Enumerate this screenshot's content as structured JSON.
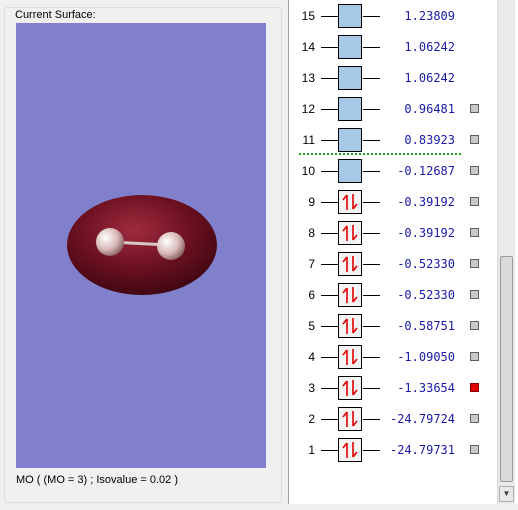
{
  "surface_group": {
    "title": "Current Surface:",
    "status": "MO ( (MO = 3) ; Isovalue = 0.02 )",
    "background_color": "#8080cc",
    "molecule": "dimer with isosurface"
  },
  "orbitals": [
    {
      "num": "15",
      "energy": "1.23809",
      "occupied": false,
      "selectable": false,
      "selected": false
    },
    {
      "num": "14",
      "energy": "1.06242",
      "occupied": false,
      "selectable": false,
      "selected": false
    },
    {
      "num": "13",
      "energy": "1.06242",
      "occupied": false,
      "selectable": false,
      "selected": false
    },
    {
      "num": "12",
      "energy": "0.96481",
      "occupied": false,
      "selectable": true,
      "selected": false
    },
    {
      "num": "11",
      "energy": "0.83923",
      "occupied": false,
      "selectable": true,
      "selected": false
    },
    {
      "num": "10",
      "energy": "-0.12687",
      "occupied": false,
      "selectable": true,
      "selected": false
    },
    {
      "num": "9",
      "energy": "-0.39192",
      "occupied": true,
      "selectable": true,
      "selected": false
    },
    {
      "num": "8",
      "energy": "-0.39192",
      "occupied": true,
      "selectable": true,
      "selected": false
    },
    {
      "num": "7",
      "energy": "-0.52330",
      "occupied": true,
      "selectable": true,
      "selected": false
    },
    {
      "num": "6",
      "energy": "-0.52330",
      "occupied": true,
      "selectable": true,
      "selected": false
    },
    {
      "num": "5",
      "energy": "-0.58751",
      "occupied": true,
      "selectable": true,
      "selected": false
    },
    {
      "num": "4",
      "energy": "-1.09050",
      "occupied": true,
      "selectable": true,
      "selected": false
    },
    {
      "num": "3",
      "energy": "-1.33654",
      "occupied": true,
      "selectable": true,
      "selected": true
    },
    {
      "num": "2",
      "energy": "-24.79724",
      "occupied": true,
      "selectable": true,
      "selected": false
    },
    {
      "num": "1",
      "energy": "-24.79731",
      "occupied": true,
      "selectable": true,
      "selected": false
    }
  ],
  "colors": {
    "unoccupied_box": "#a8c8e8",
    "energy_text": "#1a1aa6",
    "selected_marker": "#e00000",
    "homo_lumo_line": "#1ca61c",
    "spin_arrows": "#e00000"
  }
}
